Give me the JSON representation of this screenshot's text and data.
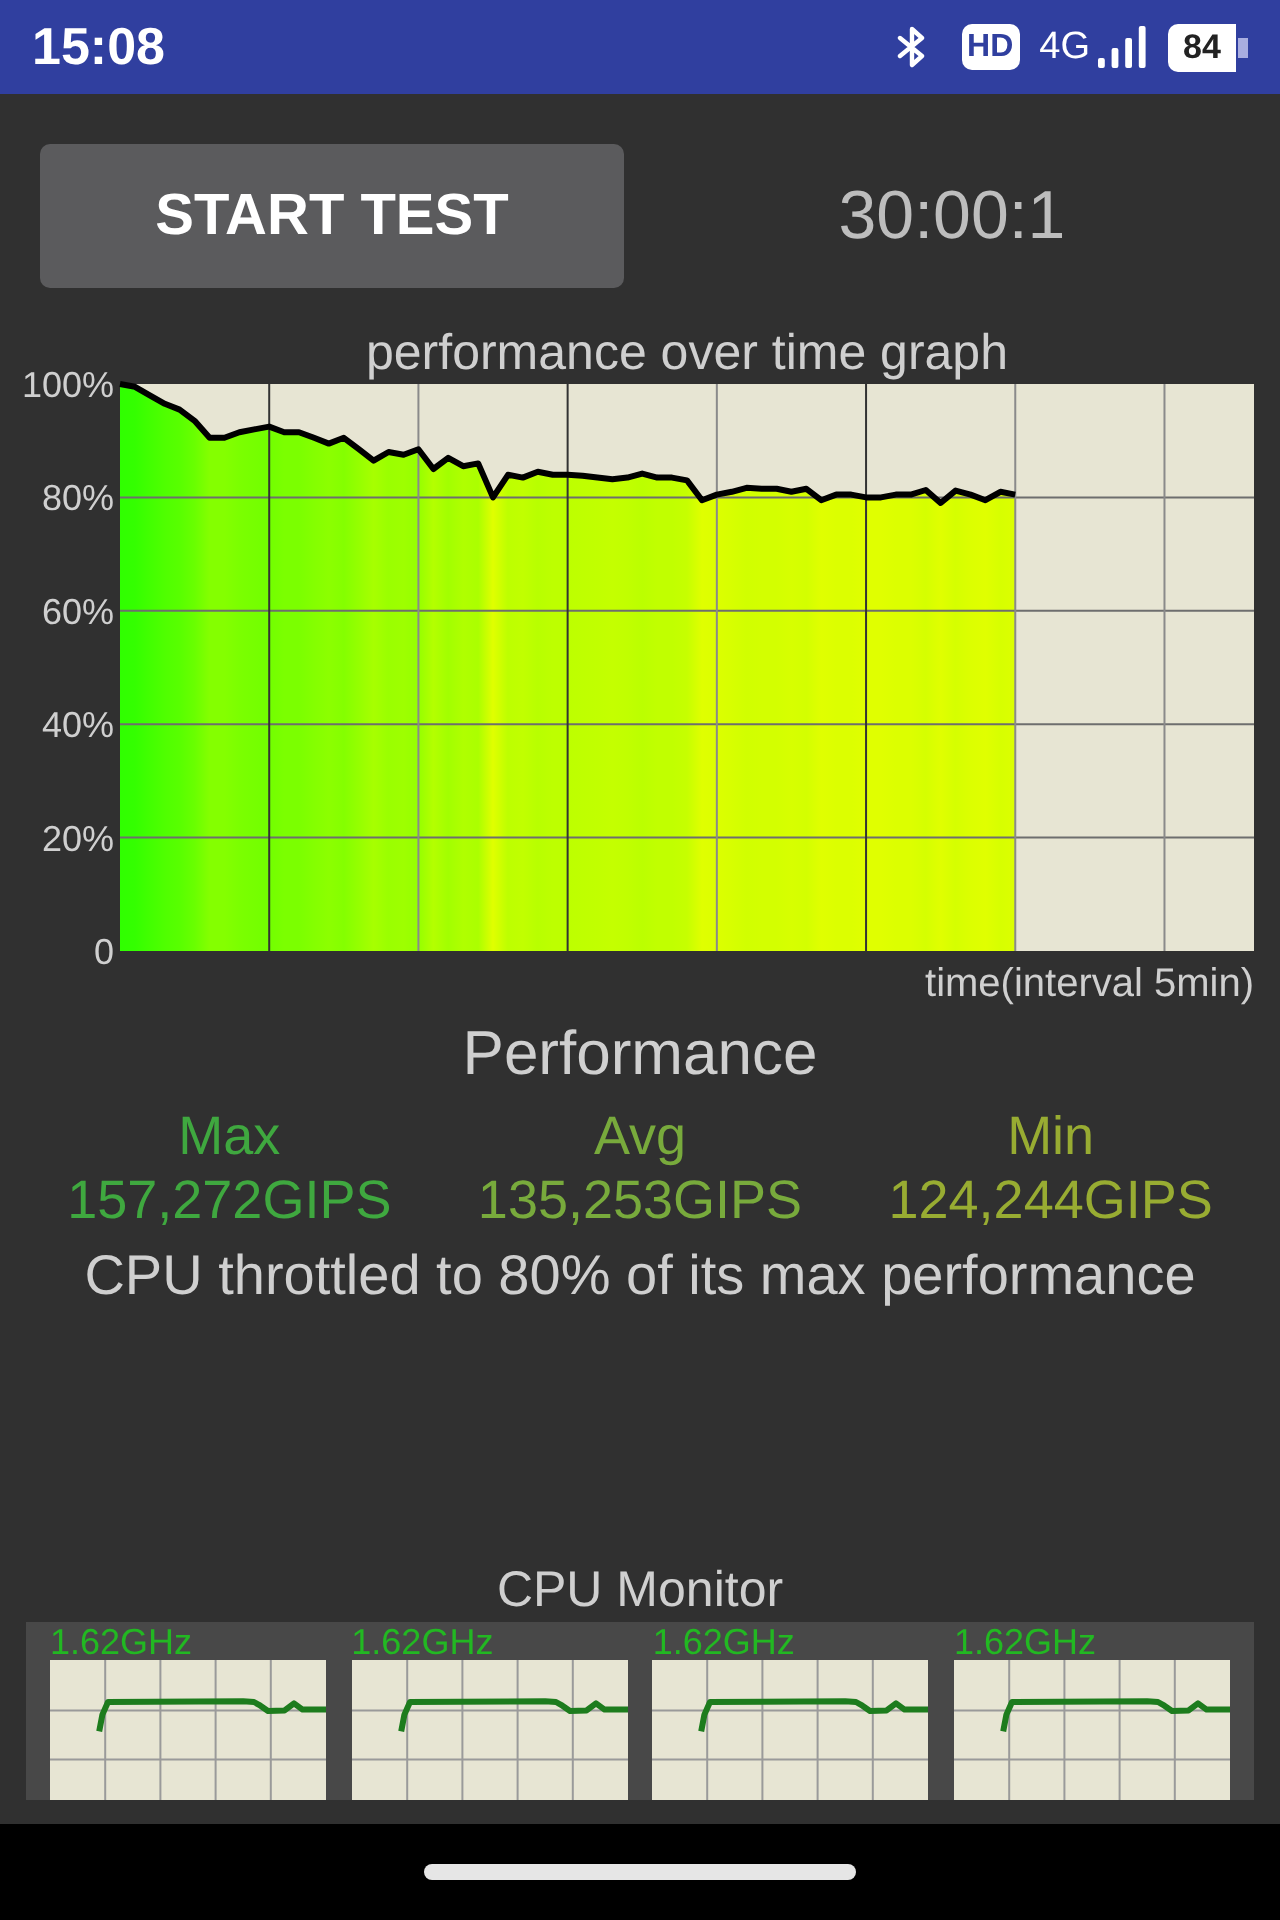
{
  "status_bar": {
    "time": "15:08",
    "hd": "HD",
    "network": "4G",
    "battery": "84"
  },
  "controls": {
    "start_button": "START TEST",
    "timer": "30:00:1"
  },
  "graph": {
    "chart_data": {
      "type": "area",
      "title": "performance over time graph",
      "xlabel": "time(interval 5min)",
      "ylim": [
        0,
        100
      ],
      "grid": true,
      "yticks": [
        {
          "value": 0,
          "label": "0"
        },
        {
          "value": 20,
          "label": "20%"
        },
        {
          "value": 40,
          "label": "40%"
        },
        {
          "value": 60,
          "label": "60%"
        },
        {
          "value": 80,
          "label": "80%"
        },
        {
          "value": 100,
          "label": "100%"
        }
      ],
      "categories": [
        null,
        null,
        null,
        null,
        null,
        null,
        null,
        null,
        null,
        null,
        null,
        null,
        null,
        null,
        null,
        null,
        null,
        null,
        null,
        null,
        null,
        null,
        null,
        null,
        null,
        null,
        null,
        null,
        null,
        null,
        null,
        null,
        null,
        null,
        null,
        null,
        null,
        null,
        null,
        null,
        null,
        null,
        null,
        null,
        null,
        null,
        null,
        null,
        null,
        null,
        null,
        null,
        null,
        null,
        null,
        null,
        null,
        null,
        null,
        null,
        null,
        null,
        null,
        null,
        null,
        null,
        null,
        null,
        null,
        null,
        null,
        null,
        null,
        null,
        null,
        null,
        null
      ],
      "series": [
        {
          "color": "#000000",
          "values": [
            100,
            99.5,
            98,
            96.5,
            95.5,
            93.5,
            90.5,
            90.5,
            91.5,
            92,
            92.5,
            91.5,
            91.5,
            90.5,
            89.5,
            90.5,
            88.5,
            86.5,
            88,
            87.5,
            88.5,
            85,
            87,
            85.5,
            86,
            80,
            84,
            83.5,
            84.5,
            84,
            84,
            83.8,
            83.5,
            83.2,
            83.5,
            84.2,
            83.5,
            83.5,
            83,
            79.5,
            80.5,
            81,
            81.7,
            81.5,
            81.5,
            81,
            81.5,
            79.5,
            80.5,
            80.5,
            80,
            80,
            80.5,
            80.5,
            81.3,
            79,
            81.2,
            80.5,
            79.5,
            81,
            80.5,
            null,
            null,
            null,
            null,
            null,
            null,
            null,
            null,
            null,
            null,
            null,
            null,
            null,
            null,
            null,
            null
          ]
        }
      ]
    }
  },
  "performance": {
    "title": "Performance",
    "stats": [
      {
        "label": "Max",
        "value": "157,272GIPS",
        "color": "#3fa83f"
      },
      {
        "label": "Avg",
        "value": "135,253GIPS",
        "color": "#78aa3c"
      },
      {
        "label": "Min",
        "value": "124,244GIPS",
        "color": "#98ac32"
      }
    ],
    "summary": "CPU throttled to 80% of its max performance"
  },
  "cpu_monitor": {
    "title": "CPU Monitor",
    "cores": [
      {
        "frequency": "1.62GHz"
      },
      {
        "frequency": "1.62GHz"
      },
      {
        "frequency": "1.62GHz"
      },
      {
        "frequency": "1.62GHz"
      }
    ]
  }
}
